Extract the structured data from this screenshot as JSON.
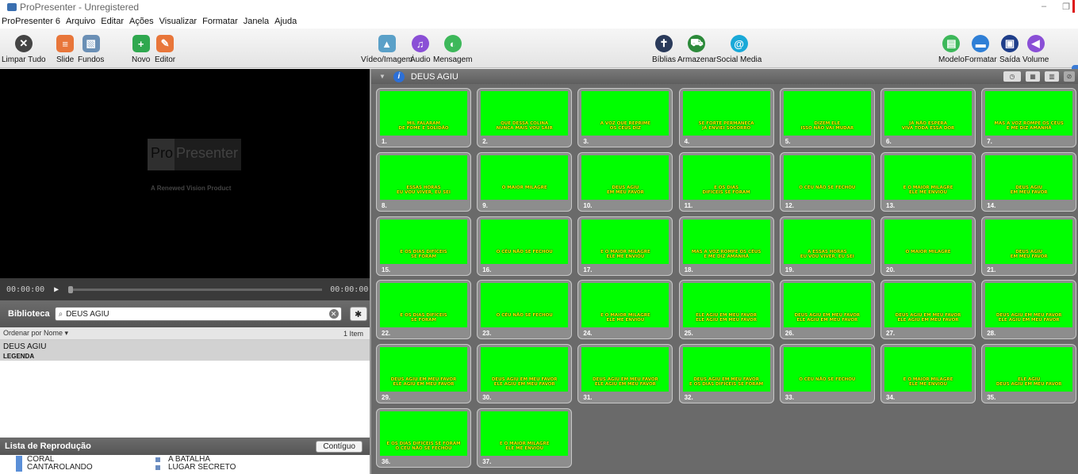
{
  "window": {
    "title": "ProPresenter - Unregistered",
    "minimize": "–",
    "restore": "❐"
  },
  "menu": [
    "ProPresenter 6",
    "Arquivo",
    "Editar",
    "Ações",
    "Visualizar",
    "Formatar",
    "Janela",
    "Ajuda"
  ],
  "toolbar": {
    "clear_all": "Limpar Tudo",
    "slide": "Slide",
    "backgrounds": "Fundos",
    "new": "Novo",
    "editor": "Editor",
    "video_image": "Vídeo/Imagem",
    "audio": "Áudio",
    "message": "Mensagem",
    "bibles": "Bíblias",
    "store": "Armazenar",
    "social_media": "Social Media",
    "template": "Modelo",
    "format": "Formatar",
    "output": "Saída",
    "volume": "Volume"
  },
  "preview": {
    "logo_pro": "Pro",
    "logo_presenter": "Presenter",
    "logo_sub": "A Renewed Vision Product"
  },
  "transport": {
    "elapsed": "00:00:00",
    "remaining": "00:00:00"
  },
  "library": {
    "label": "Biblioteca",
    "search_value": "DEUS AGIU",
    "sort_label": "Ordenar por Nome",
    "count": "1 Item",
    "items": [
      {
        "name": "DEUS AGIU",
        "sub": "LEGENDA"
      }
    ]
  },
  "playlist": {
    "label": "Lista de Reprodução",
    "contiguous": "Contíguo",
    "left": [
      "CORAL",
      "CANTAROLANDO"
    ],
    "right": [
      "A BATALHA",
      "LUGAR SECRETO"
    ]
  },
  "grid": {
    "presentation_title": "DEUS AGIU",
    "slides": [
      {
        "n": "1.",
        "l1": "MIL FALARAM",
        "l2": "DE FOME E SOLIDÃO"
      },
      {
        "n": "2.",
        "l1": "QUE DESSA COLINA",
        "l2": "NUNCA MAIS VOU SAIR"
      },
      {
        "n": "3.",
        "l1": "A VOZ QUE REPRIME",
        "l2": "OS CÉUS DIZ"
      },
      {
        "n": "4.",
        "l1": "SE FORTE PERMANECA",
        "l2": "JÁ ENVIEI SOCORRO"
      },
      {
        "n": "5.",
        "l1": "DIZEM ELE",
        "l2": "ISSO NÃO VAI MUDAR"
      },
      {
        "n": "6.",
        "l1": "JÁ NÃO ESPERA",
        "l2": "VIVA TODA ESSA DOR"
      },
      {
        "n": "7.",
        "l1": "MAS A VOZ ROMPE OS CÉUS",
        "l2": "E ME DIZ AMANHÃ"
      },
      {
        "n": "8.",
        "l1": "ESSAS HORAS",
        "l2": "EU VOU VIVER, EU SEI"
      },
      {
        "n": "9.",
        "l1": "O MAIOR MILAGRE",
        "l2": ""
      },
      {
        "n": "10.",
        "l1": "DEUS AGIU",
        "l2": "EM MEU FAVOR"
      },
      {
        "n": "11.",
        "l1": "E OS DIAS",
        "l2": "DIFÍCEIS SE FORAM"
      },
      {
        "n": "12.",
        "l1": "O CÉU NÃO SE FECHOU",
        "l2": ""
      },
      {
        "n": "13.",
        "l1": "E O MAIOR MILAGRE",
        "l2": "ELE ME ENVIOU"
      },
      {
        "n": "14.",
        "l1": "DEUS AGIU",
        "l2": "EM MEU FAVOR"
      },
      {
        "n": "15.",
        "l1": "E OS DIAS DIFÍCEIS",
        "l2": "SE FORAM"
      },
      {
        "n": "16.",
        "l1": "O CÉU NÃO SE FECHOU",
        "l2": ""
      },
      {
        "n": "17.",
        "l1": "E O MAIOR MILAGRE",
        "l2": "ELE ME ENVIOU"
      },
      {
        "n": "18.",
        "l1": "MAS A VOZ ROMPE OS CÉUS",
        "l2": "E ME DIZ AMANHÃ"
      },
      {
        "n": "19.",
        "l1": "A ESSAS HORAS",
        "l2": "EU VOU VIVER, EU SEI"
      },
      {
        "n": "20.",
        "l1": "O MAIOR MILAGRE",
        "l2": ""
      },
      {
        "n": "21.",
        "l1": "DEUS AGIU",
        "l2": "EM MEU FAVOR"
      },
      {
        "n": "22.",
        "l1": "E OS DIAS DIFÍCEIS",
        "l2": "SE FORAM"
      },
      {
        "n": "23.",
        "l1": "O CÉU NÃO SE FECHOU",
        "l2": ""
      },
      {
        "n": "24.",
        "l1": "E O MAIOR MILAGRE",
        "l2": "ELE ME ENVIOU"
      },
      {
        "n": "25.",
        "l1": "ELE AGIU EM MEU FAVOR",
        "l2": "ELE AGIU EM MEU FAVOR"
      },
      {
        "n": "26.",
        "l1": "DEUS AGIU EM MEU FAVOR",
        "l2": "ELE AGIU EM MEU FAVOR"
      },
      {
        "n": "27.",
        "l1": "DEUS AGIU EM MEU FAVOR",
        "l2": "ELE AGIU EM MEU FAVOR"
      },
      {
        "n": "28.",
        "l1": "DEUS AGIU EM MEU FAVOR",
        "l2": "ELE AGIU EM MEU FAVOR"
      },
      {
        "n": "29.",
        "l1": "DEUS AGIU EM MEU FAVOR",
        "l2": "ELE AGIU EM MEU FAVOR"
      },
      {
        "n": "30.",
        "l1": "DEUS AGIU EM MEU FAVOR",
        "l2": "ELE AGIU EM MEU FAVOR"
      },
      {
        "n": "31.",
        "l1": "DEUS AGIU EM MEU FAVOR",
        "l2": "ELE AGIU EM MEU FAVOR"
      },
      {
        "n": "32.",
        "l1": "DEUS AGIU EM MEU FAVOR",
        "l2": "E OS DIAS DIFÍCEIS SE FORAM"
      },
      {
        "n": "33.",
        "l1": "O CÉU NÃO SE FECHOU",
        "l2": ""
      },
      {
        "n": "34.",
        "l1": "E O MAIOR MILAGRE",
        "l2": "ELE ME ENVIOU"
      },
      {
        "n": "35.",
        "l1": "ELE AGIU",
        "l2": "DEUS AGIU EM MEU FAVOR"
      },
      {
        "n": "36.",
        "l1": "E OS DIAS DIFÍCEIS SE FORAM",
        "l2": "O CÉU NÃO SE FECHOU"
      },
      {
        "n": "37.",
        "l1": "E O MAIOR MILAGRE",
        "l2": "ELE ME ENVIOU"
      }
    ]
  },
  "colors": {
    "slide_bg": "#00ff00",
    "slide_text": "#ffff00",
    "accent": "#2c6fd6"
  }
}
